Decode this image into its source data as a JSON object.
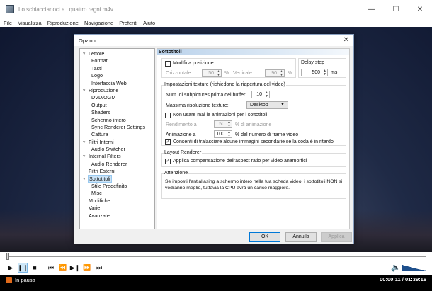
{
  "window": {
    "title": "Lo schiaccianoci e i quattro regni.m4v",
    "menu": [
      "File",
      "Visualizza",
      "Riproduzione",
      "Navigazione",
      "Preferiti",
      "Aiuto"
    ]
  },
  "dialog": {
    "title": "Opzioni",
    "tree": [
      {
        "label": "Lettore",
        "level": 0,
        "expanded": true
      },
      {
        "label": "Formati",
        "level": 1
      },
      {
        "label": "Tasti",
        "level": 1
      },
      {
        "label": "Logo",
        "level": 1
      },
      {
        "label": "Interfaccia Web",
        "level": 1
      },
      {
        "label": "Riproduzione",
        "level": 0,
        "expanded": true
      },
      {
        "label": "DVD/OGM",
        "level": 1
      },
      {
        "label": "Output",
        "level": 1
      },
      {
        "label": "Shaders",
        "level": 1
      },
      {
        "label": "Schermo intero",
        "level": 1
      },
      {
        "label": "Sync Renderer Settings",
        "level": 1
      },
      {
        "label": "Cattura",
        "level": 1
      },
      {
        "label": "Filtri Interni",
        "level": 0,
        "expanded": true
      },
      {
        "label": "Audio Switcher",
        "level": 1
      },
      {
        "label": "Internal Filters",
        "level": 0,
        "expanded": true
      },
      {
        "label": "Audio Renderer",
        "level": 1
      },
      {
        "label": "Filtri Esterni",
        "level": 0
      },
      {
        "label": "Sottotitoli",
        "level": 0,
        "expanded": true,
        "selected": true
      },
      {
        "label": "Stile Predefinito",
        "level": 1
      },
      {
        "label": "Misc",
        "level": 1
      },
      {
        "label": "Modifiche",
        "level": 0
      },
      {
        "label": "Varie",
        "level": 0
      },
      {
        "label": "Avanzate",
        "level": 0
      }
    ],
    "page_title": "Sottotitoli",
    "modifica_posizione": {
      "label": "Modifica posizione",
      "checked": false
    },
    "orizzontale": {
      "label": "Orizzontale:",
      "value": "50",
      "unit": "%"
    },
    "verticale": {
      "label": "Verticale:",
      "value": "90",
      "unit": "%"
    },
    "delay": {
      "label": "Delay step",
      "value": "500",
      "unit": "ms"
    },
    "texture_group": {
      "title": "Impostazioni texture (richiedono la riapertura del video)",
      "buffer_label": "Num. di subpictures prima del buffer:",
      "buffer_value": "10",
      "resolution_label": "Massima risoluzione texture:",
      "resolution_value": "Desktop",
      "no_anim_label": "Non usare mai le animazioni per i sottotitoli",
      "no_anim_checked": false,
      "rendimento_label": "Rendimento a",
      "rendimento_value": "50",
      "rendimento_suffix": "% di animazione",
      "animazione_label": "Animazione a",
      "animazione_value": "100",
      "animazione_suffix": "% del numero di frame video",
      "skip_label": "Consenti di tralasciare alcune immagini secondarie se la coda è in ritardo",
      "skip_checked": true
    },
    "layout_group": {
      "title": "Layout Renderer",
      "aspect_label": "Applica compensazione dell'aspect ratio per video anamorfici",
      "aspect_checked": true
    },
    "attention_group": {
      "title": "Attenzione",
      "text": "Se imposti l'antialiasing a schermo intero nella tua scheda video, i sottotitoli NON si vedranno meglio, tuttavia la CPU avrà un carico maggiore."
    },
    "buttons": {
      "ok": "OK",
      "cancel": "Annulla",
      "apply": "Applica"
    }
  },
  "player": {
    "status": "In pausa",
    "time": "00:00:11 / 01:39:16",
    "progress_fraction": 0.002,
    "volume_fraction": 1.0,
    "icons": [
      "play-icon",
      "pause-icon",
      "stop-icon",
      "prev-icon",
      "rewind-icon",
      "frame-step-icon",
      "fast-forward-icon",
      "next-icon",
      "speaker-icon"
    ]
  }
}
